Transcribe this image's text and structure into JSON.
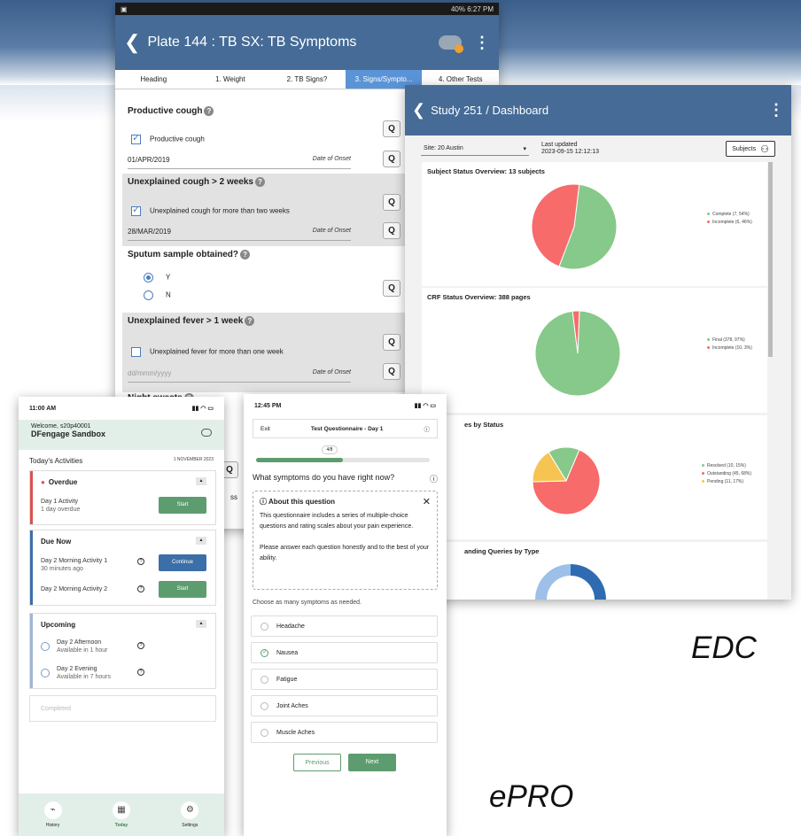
{
  "captions": {
    "edc": "EDC",
    "epro": "ePRO"
  },
  "plate": {
    "status_right": "40% 6:27 PM",
    "title": "Plate 144 : TB SX: TB Symptoms",
    "tabs": [
      "Heading",
      "1. Weight",
      "2. TB Signs?",
      "3. Signs/Sympto...",
      "4. Other Tests"
    ],
    "active_tab_index": 3,
    "q_label": "Q",
    "date_of_onset": "Date of Onset",
    "questions": {
      "productive_cough": {
        "title": "Productive cough",
        "check_label": "Productive cough",
        "checked": true,
        "date": "01/APR/2019"
      },
      "unexplained_cough": {
        "title": "Unexplained cough > 2 weeks",
        "check_label": "Unexplained cough for more than two weeks",
        "checked": true,
        "date": "28/MAR/2019"
      },
      "sputum": {
        "title": "Sputum sample obtained?",
        "options": [
          "Y",
          "N"
        ],
        "selected": "Y"
      },
      "fever": {
        "title": "Unexplained fever > 1 week",
        "check_label": "Unexplained fever for more than one week",
        "checked": false,
        "date_placeholder": "dd/mmm/yyyy"
      },
      "night_sweats": {
        "title": "Night sweats"
      }
    },
    "stray_text": "ss"
  },
  "dashboard": {
    "title_study": "Study 251",
    "title_page": "/ Dashboard",
    "site": "Site: 20 Austin",
    "last_updated_label": "Last updated",
    "last_updated_value": "2023-09-15 12:12:13",
    "subjects_button": "Subjects",
    "cards": [
      {
        "title": "Subject Status Overview: 13 subjects",
        "legend": [
          "Complete (7, 54%)",
          "Incomplete (6, 46%)"
        ]
      },
      {
        "title": "CRF Status Overview: 388 pages",
        "legend": [
          "Final (378, 97%)",
          "Incomplete (10, 3%)"
        ]
      },
      {
        "title": "es by Status",
        "legend": [
          "Resolved (10, 15%)",
          "Outstanding (45, 68%)",
          "Pending (11, 17%)"
        ]
      },
      {
        "title": "anding Queries by Type",
        "legend": []
      }
    ],
    "colors": {
      "green": "#86c98a",
      "red": "#f76b6b",
      "yellow": "#f5c451",
      "blue": "#2f6bb0",
      "lightblue": "#9cc0e8"
    }
  },
  "chart_data": [
    {
      "type": "pie",
      "title": "Subject Status Overview: 13 subjects",
      "categories": [
        "Complete",
        "Incomplete"
      ],
      "values": [
        7,
        6
      ],
      "legend_position": "right"
    },
    {
      "type": "pie",
      "title": "CRF Status Overview: 388 pages",
      "categories": [
        "Final",
        "Incomplete"
      ],
      "values": [
        378,
        10
      ],
      "legend_position": "right"
    },
    {
      "type": "pie",
      "title": "es by Status",
      "categories": [
        "Resolved",
        "Outstanding",
        "Pending"
      ],
      "values": [
        10,
        45,
        11
      ],
      "legend_position": "right"
    }
  ],
  "epro_left": {
    "time": "11:00 AM",
    "welcome": "Welcome, s20p40001",
    "site_name": "DFengage Sandbox",
    "todays": "Today's Activities",
    "date": "1 NOVEMBER 2023",
    "overdue": {
      "title": "Overdue",
      "item": "Day 1 Activity",
      "sub": "1 day overdue",
      "btn": "Start"
    },
    "due_now": {
      "title": "Due Now",
      "item1": "Day 2 Morning Activity 1",
      "item1_sub": "30 minutes ago",
      "btn1": "Continue",
      "item2": "Day 2 Morning Activity 2",
      "btn2": "Start"
    },
    "upcoming": {
      "title": "Upcoming",
      "item1": "Day 2 Afternoon",
      "item1_sub": "Available in 1 hour",
      "item2": "Day 2 Evening",
      "item2_sub": "Available in 7 hours"
    },
    "completed": "Completed",
    "nav": [
      "History",
      "Today",
      "Settings"
    ]
  },
  "epro_right": {
    "time": "12:45 PM",
    "exit": "Exit",
    "qtitle": "Test Questionnaire - Day 1",
    "progress_label": "4/8",
    "progress": 0.5,
    "question": "What symptoms do you have right now?",
    "about_title": "About this question",
    "about_text1": "This questionnaire includes a series of multiple-choice questions and rating scales about your pain experience.",
    "about_text2": "Please answer each question honestly and to the best of your ability.",
    "choose": "Choose as many symptoms as needed.",
    "options": [
      "Headache",
      "Nausea",
      "Fatigue",
      "Joint Aches",
      "Muscle Aches"
    ],
    "selected": "Nausea",
    "previous": "Previous",
    "next": "Next"
  }
}
